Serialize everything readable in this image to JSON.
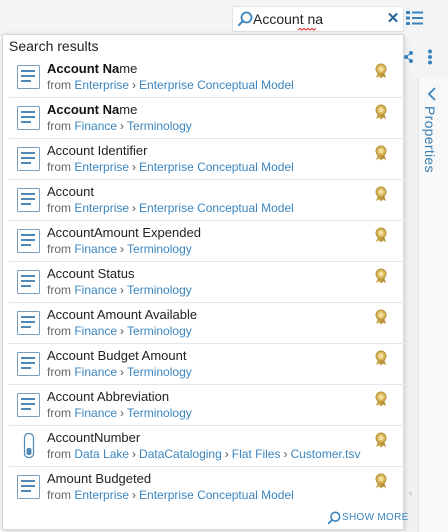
{
  "search": {
    "query": "Account na",
    "clear_label": "✕"
  },
  "dropdown": {
    "header": "Search results",
    "show_more": "SHOW MORE"
  },
  "properties_panel": {
    "label": "Properties"
  },
  "results": [
    {
      "title_bold": "Account Na",
      "title_rest": "me",
      "from": "from",
      "path": [
        "Enterprise",
        "Enterprise Conceptual Model"
      ],
      "icon": "term-icon"
    },
    {
      "title_bold": "Account Na",
      "title_rest": "me",
      "from": "from",
      "path": [
        "Finance",
        "Terminology"
      ],
      "icon": "term-icon"
    },
    {
      "title_bold": "",
      "title_rest": "Account Identifier",
      "from": "from",
      "path": [
        "Enterprise",
        "Enterprise Conceptual Model"
      ],
      "icon": "term-icon"
    },
    {
      "title_bold": "",
      "title_rest": "Account",
      "from": "from",
      "path": [
        "Enterprise",
        "Enterprise Conceptual Model"
      ],
      "icon": "term-icon"
    },
    {
      "title_bold": "",
      "title_rest": "AccountAmount Expended",
      "from": "from",
      "path": [
        "Finance",
        "Terminology"
      ],
      "icon": "term-icon"
    },
    {
      "title_bold": "",
      "title_rest": "Account Status",
      "from": "from",
      "path": [
        "Finance",
        "Terminology"
      ],
      "icon": "term-icon"
    },
    {
      "title_bold": "",
      "title_rest": "Account Amount Available",
      "from": "from",
      "path": [
        "Finance",
        "Terminology"
      ],
      "icon": "term-icon"
    },
    {
      "title_bold": "",
      "title_rest": "Account Budget Amount",
      "from": "from",
      "path": [
        "Finance",
        "Terminology"
      ],
      "icon": "term-icon"
    },
    {
      "title_bold": "",
      "title_rest": "Account Abbreviation",
      "from": "from",
      "path": [
        "Finance",
        "Terminology"
      ],
      "icon": "term-icon"
    },
    {
      "title_bold": "",
      "title_rest": "AccountNumber",
      "from": "from",
      "path": [
        "Data Lake",
        "DataCataloging",
        "Flat Files",
        "Customer.tsv"
      ],
      "icon": "column-icon"
    },
    {
      "title_bold": "",
      "title_rest": "Amount Budgeted",
      "from": "from",
      "path": [
        "Enterprise",
        "Enterprise Conceptual Model"
      ],
      "icon": "term-icon"
    }
  ],
  "path_separator": "›",
  "colors": {
    "accent": "#3a85bf",
    "badge": "#c9a64a",
    "term_icon": "#4d88b8"
  }
}
